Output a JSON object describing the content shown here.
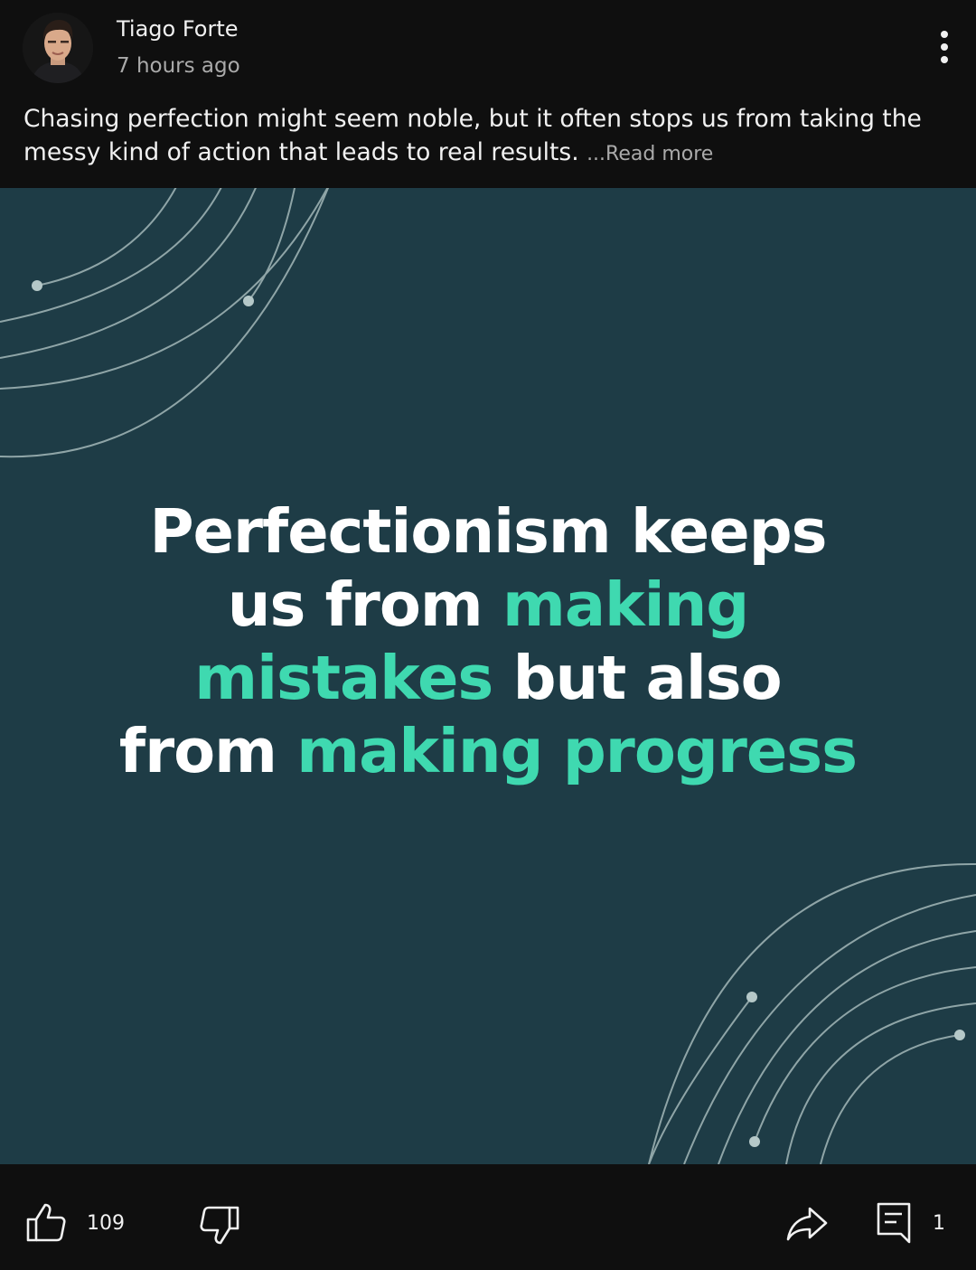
{
  "post": {
    "author": "Tiago Forte",
    "time": "7 hours ago",
    "caption": "Chasing perfection might seem noble, but it often stops us from taking the messy kind of action that leads to real results.",
    "read_more": "...Read more"
  },
  "image": {
    "lines": [
      [
        {
          "text": "Perfectionism keeps",
          "accent": false
        }
      ],
      [
        {
          "text": "us from ",
          "accent": false
        },
        {
          "text": "making",
          "accent": true
        }
      ],
      [
        {
          "text": "mistakes",
          "accent": true
        },
        {
          "text": " but also",
          "accent": false
        }
      ],
      [
        {
          "text": "from ",
          "accent": false
        },
        {
          "text": "making progress",
          "accent": true
        }
      ]
    ],
    "background_color": "#1e3c46",
    "accent_color": "#3fd9b0"
  },
  "actions": {
    "like_count": "109",
    "comment_count": "1"
  },
  "icons": {
    "menu": "more-vertical-icon",
    "like": "thumbs-up-icon",
    "dislike": "thumbs-down-icon",
    "share": "share-icon",
    "comment": "comment-icon"
  }
}
